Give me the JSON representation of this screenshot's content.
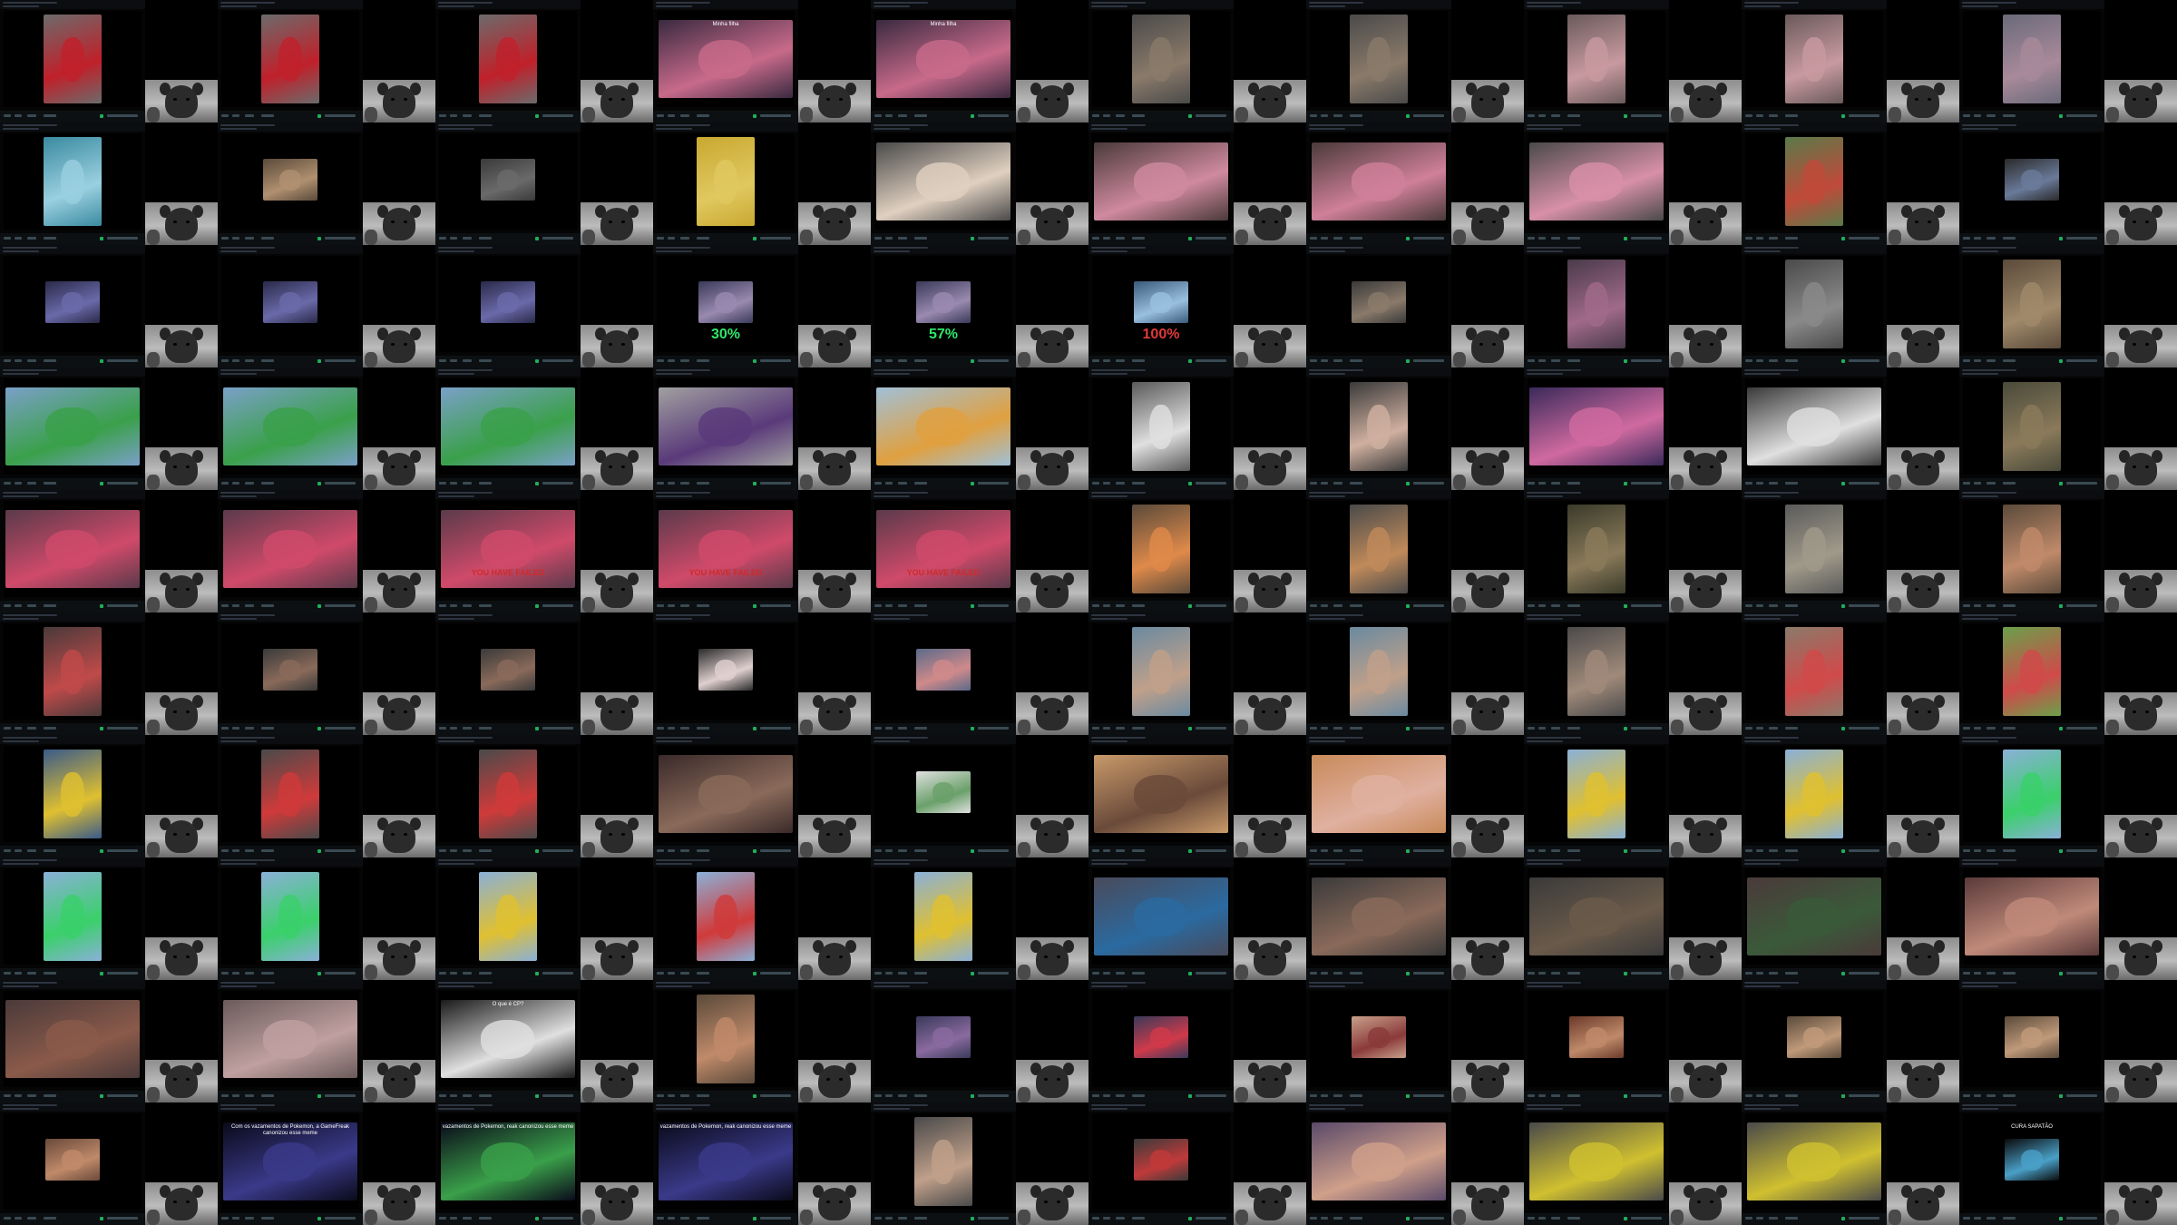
{
  "screen": {
    "title": ""
  },
  "tiles": [
    {
      "bg": "#6b6b6b",
      "accent": "#c0202a",
      "shape": "tall",
      "caption": "",
      "overlay": "",
      "overlayColor": "#fff"
    },
    {
      "bg": "#6b6b6b",
      "accent": "#c0202a",
      "shape": "tall",
      "caption": "",
      "overlay": "",
      "overlayColor": "#fff"
    },
    {
      "bg": "#6b6b6b",
      "accent": "#c0202a",
      "shape": "tall",
      "caption": "",
      "overlay": "",
      "overlayColor": "#fff"
    },
    {
      "bg": "#3a2a40",
      "accent": "#c86a8a",
      "shape": "wide",
      "caption": "Minha filha",
      "overlay": "",
      "overlayColor": "#fff"
    },
    {
      "bg": "#3a2a40",
      "accent": "#c86a8a",
      "shape": "wide",
      "caption": "Minha filha",
      "overlay": "",
      "overlayColor": "#fff"
    },
    {
      "bg": "#4a4a4a",
      "accent": "#8a7a6a",
      "shape": "tall",
      "caption": "",
      "overlay": "",
      "overlayColor": "#fff"
    },
    {
      "bg": "#4a4a4a",
      "accent": "#8a7a6a",
      "shape": "tall",
      "caption": "",
      "overlay": "",
      "overlayColor": "#fff"
    },
    {
      "bg": "#6a5a5a",
      "accent": "#c89aa0",
      "shape": "tall",
      "caption": "",
      "overlay": "",
      "overlayColor": "#fff"
    },
    {
      "bg": "#6a5a5a",
      "accent": "#c89aa0",
      "shape": "tall",
      "caption": "",
      "overlay": "",
      "overlayColor": "#fff"
    },
    {
      "bg": "#6a6a7a",
      "accent": "#a88a9a",
      "shape": "tall",
      "caption": "",
      "overlay": "",
      "overlayColor": "#fff"
    },
    {
      "bg": "#3a8aa0",
      "accent": "#9ad0e0",
      "shape": "tall",
      "caption": "",
      "overlay": "",
      "overlayColor": "#fff"
    },
    {
      "bg": "#5a4a3a",
      "accent": "#b09070",
      "shape": "small",
      "caption": "",
      "overlay": "",
      "overlayColor": "#fff"
    },
    {
      "bg": "#3a3a3a",
      "accent": "#6a6a6a",
      "shape": "small",
      "caption": "",
      "overlay": "",
      "overlayColor": "#fff"
    },
    {
      "bg": "#c8a830",
      "accent": "#e0c860",
      "shape": "tall",
      "caption": "",
      "overlay": "",
      "overlayColor": "#fff"
    },
    {
      "bg": "#4a4a4a",
      "accent": "#e0d0c0",
      "shape": "wide",
      "caption": "",
      "overlay": "",
      "overlayColor": "#fff"
    },
    {
      "bg": "#4a3a3a",
      "accent": "#d08aa0",
      "shape": "wide",
      "caption": "",
      "overlay": "",
      "overlayColor": "#fff"
    },
    {
      "bg": "#4a3a3a",
      "accent": "#d0809a",
      "shape": "wide",
      "caption": "",
      "overlay": "",
      "overlayColor": "#fff"
    },
    {
      "bg": "#4a4a4a",
      "accent": "#d890a8",
      "shape": "wide",
      "caption": "",
      "overlay": "",
      "overlayColor": "#fff"
    },
    {
      "bg": "#5a7a4a",
      "accent": "#c04a3a",
      "shape": "tall",
      "caption": "",
      "overlay": "",
      "overlayColor": "#fff"
    },
    {
      "bg": "#2a2a2a",
      "accent": "#6a7a9a",
      "shape": "small",
      "caption": "",
      "overlay": "",
      "overlayColor": "#fff"
    },
    {
      "bg": "#2a2a4a",
      "accent": "#6a6aaa",
      "shape": "small",
      "caption": "",
      "overlay": "",
      "overlayColor": "#fff"
    },
    {
      "bg": "#2a2a4a",
      "accent": "#6a6aaa",
      "shape": "small",
      "caption": "",
      "overlay": "",
      "overlayColor": "#fff"
    },
    {
      "bg": "#2a2a4a",
      "accent": "#6a6aaa",
      "shape": "small",
      "caption": "",
      "overlay": "",
      "overlayColor": "#fff"
    },
    {
      "bg": "#3a3a5a",
      "accent": "#9a8ab0",
      "shape": "small",
      "caption": "",
      "overlay": "30%",
      "overlayColor": "#2ee86a"
    },
    {
      "bg": "#3a3a5a",
      "accent": "#9a8ab0",
      "shape": "small",
      "caption": "",
      "overlay": "57%",
      "overlayColor": "#2ee86a"
    },
    {
      "bg": "#3a5a7a",
      "accent": "#9ac0e0",
      "shape": "small",
      "caption": "",
      "overlay": "100%",
      "overlayColor": "#e23a3a"
    },
    {
      "bg": "#3a3a3a",
      "accent": "#8a7a6a",
      "shape": "small",
      "caption": "",
      "overlay": "",
      "overlayColor": "#fff"
    },
    {
      "bg": "#4a3a4a",
      "accent": "#a06a8a",
      "shape": "tall",
      "caption": "",
      "overlay": "",
      "overlayColor": "#fff"
    },
    {
      "bg": "#4a4a4a",
      "accent": "#8a8a8a",
      "shape": "tall",
      "caption": "",
      "overlay": "",
      "overlayColor": "#fff"
    },
    {
      "bg": "#5a4a3a",
      "accent": "#a08a6a",
      "shape": "tall",
      "caption": "",
      "overlay": "",
      "overlayColor": "#fff"
    },
    {
      "bg": "#7aa0c8",
      "accent": "#3aa04a",
      "shape": "wide",
      "caption": "",
      "overlay": "",
      "overlayColor": "#fff"
    },
    {
      "bg": "#7aa0c8",
      "accent": "#3aa04a",
      "shape": "wide",
      "caption": "",
      "overlay": "",
      "overlayColor": "#fff"
    },
    {
      "bg": "#7aa0c8",
      "accent": "#3aa04a",
      "shape": "wide",
      "caption": "",
      "overlay": "",
      "overlayColor": "#fff"
    },
    {
      "bg": "#a0a0a0",
      "accent": "#5a3a7a",
      "shape": "wide",
      "caption": "",
      "overlay": "",
      "overlayColor": "#fff"
    },
    {
      "bg": "#a0c0d8",
      "accent": "#e0a040",
      "shape": "wide",
      "caption": "",
      "overlay": "",
      "overlayColor": "#fff"
    },
    {
      "bg": "#5a5a5a",
      "accent": "#e0e0e0",
      "shape": "tall",
      "caption": "",
      "overlay": "",
      "overlayColor": "#fff"
    },
    {
      "bg": "#3a3a3a",
      "accent": "#d0b0a0",
      "shape": "tall",
      "caption": "",
      "overlay": "",
      "overlayColor": "#fff"
    },
    {
      "bg": "#3a2a5a",
      "accent": "#d06aa0",
      "shape": "wide",
      "caption": "",
      "overlay": "",
      "overlayColor": "#fff"
    },
    {
      "bg": "#3a3a3a",
      "accent": "#e0e0e0",
      "shape": "wide",
      "caption": "",
      "overlay": "",
      "overlayColor": "#fff"
    },
    {
      "bg": "#4a4a3a",
      "accent": "#8a7a5a",
      "shape": "tall",
      "caption": "",
      "overlay": "",
      "overlayColor": "#fff"
    },
    {
      "bg": "#5a3a4a",
      "accent": "#d04a6a",
      "shape": "wide",
      "caption": "",
      "overlay": "",
      "overlayColor": "#fff"
    },
    {
      "bg": "#5a3a4a",
      "accent": "#d04a6a",
      "shape": "wide",
      "caption": "",
      "overlay": "",
      "overlayColor": "#fff"
    },
    {
      "bg": "#5a3a4a",
      "accent": "#d04a6a",
      "shape": "wide",
      "caption": "",
      "overlay": "YOU HAVE FAILED",
      "overlayColor": "#d02a2a"
    },
    {
      "bg": "#5a3a4a",
      "accent": "#d04a6a",
      "shape": "wide",
      "caption": "",
      "overlay": "YOU HAVE FAILED",
      "overlayColor": "#d02a2a"
    },
    {
      "bg": "#5a3a4a",
      "accent": "#d04a6a",
      "shape": "wide",
      "caption": "",
      "overlay": "YOU HAVE FAILED",
      "overlayColor": "#d02a2a"
    },
    {
      "bg": "#5a4a3a",
      "accent": "#e08a4a",
      "shape": "tall",
      "caption": "",
      "overlay": "",
      "overlayColor": "#fff"
    },
    {
      "bg": "#4a4a4a",
      "accent": "#c08a5a",
      "shape": "tall",
      "caption": "",
      "overlay": "",
      "overlayColor": "#fff"
    },
    {
      "bg": "#3a3a2a",
      "accent": "#8a7a5a",
      "shape": "tall",
      "caption": "",
      "overlay": "",
      "overlayColor": "#fff"
    },
    {
      "bg": "#5a5a5a",
      "accent": "#a09a8a",
      "shape": "tall",
      "caption": "",
      "overlay": "",
      "overlayColor": "#fff"
    },
    {
      "bg": "#5a4a3a",
      "accent": "#c08a6a",
      "shape": "tall",
      "caption": "",
      "overlay": "",
      "overlayColor": "#fff"
    },
    {
      "bg": "#4a3a3a",
      "accent": "#c04a4a",
      "shape": "tall",
      "caption": "",
      "overlay": "",
      "overlayColor": "#fff"
    },
    {
      "bg": "#3a3a3a",
      "accent": "#8a6a5a",
      "shape": "small",
      "caption": "",
      "overlay": "",
      "overlayColor": "#fff"
    },
    {
      "bg": "#3a3a3a",
      "accent": "#8a6a5a",
      "shape": "small",
      "caption": "",
      "overlay": "",
      "overlayColor": "#fff"
    },
    {
      "bg": "#2a2a2a",
      "accent": "#e0d0d0",
      "shape": "small",
      "caption": "",
      "overlay": "",
      "overlayColor": "#fff"
    },
    {
      "bg": "#5a6a8a",
      "accent": "#d08a8a",
      "shape": "small",
      "caption": "",
      "overlay": "",
      "overlayColor": "#fff"
    },
    {
      "bg": "#6a8aa0",
      "accent": "#c0a08a",
      "shape": "tall",
      "caption": "",
      "overlay": "",
      "overlayColor": "#fff"
    },
    {
      "bg": "#6a8aa0",
      "accent": "#c0a08a",
      "shape": "tall",
      "caption": "",
      "overlay": "",
      "overlayColor": "#fff"
    },
    {
      "bg": "#4a4a4a",
      "accent": "#a08a7a",
      "shape": "tall",
      "caption": "",
      "overlay": "",
      "overlayColor": "#fff"
    },
    {
      "bg": "#8a7a6a",
      "accent": "#d04a4a",
      "shape": "tall",
      "caption": "",
      "overlay": "",
      "overlayColor": "#fff"
    },
    {
      "bg": "#6aa04a",
      "accent": "#d04a4a",
      "shape": "tall",
      "caption": "",
      "overlay": "",
      "overlayColor": "#fff"
    },
    {
      "bg": "#3a5a8a",
      "accent": "#e0c030",
      "shape": "tall",
      "caption": "",
      "overlay": "",
      "overlayColor": "#fff"
    },
    {
      "bg": "#4a4a4a",
      "accent": "#d03a3a",
      "shape": "tall",
      "caption": "",
      "overlay": "",
      "overlayColor": "#fff"
    },
    {
      "bg": "#4a4a4a",
      "accent": "#d03a3a",
      "shape": "tall",
      "caption": "",
      "overlay": "",
      "overlayColor": "#fff"
    },
    {
      "bg": "#3a2a2a",
      "accent": "#8a6a5a",
      "shape": "wide",
      "caption": "",
      "overlay": "",
      "overlayColor": "#fff"
    },
    {
      "bg": "#e0e0e0",
      "accent": "#6aa06a",
      "shape": "small",
      "caption": "",
      "overlay": "",
      "overlayColor": "#fff"
    },
    {
      "bg": "#c89a6a",
      "accent": "#6a4a3a",
      "shape": "wide",
      "caption": "",
      "overlay": "",
      "overlayColor": "#fff"
    },
    {
      "bg": "#c88a5a",
      "accent": "#e0b0a0",
      "shape": "wide",
      "caption": "",
      "overlay": "",
      "overlayColor": "#fff"
    },
    {
      "bg": "#8ab0d8",
      "accent": "#e0c030",
      "shape": "tall",
      "caption": "",
      "overlay": "",
      "overlayColor": "#fff"
    },
    {
      "bg": "#8ab0d8",
      "accent": "#e0c030",
      "shape": "tall",
      "caption": "",
      "overlay": "",
      "overlayColor": "#fff"
    },
    {
      "bg": "#8ab0d8",
      "accent": "#3ad06a",
      "shape": "tall",
      "caption": "",
      "overlay": "",
      "overlayColor": "#fff"
    },
    {
      "bg": "#8ab0d8",
      "accent": "#3ad06a",
      "shape": "tall",
      "caption": "",
      "overlay": "",
      "overlayColor": "#fff"
    },
    {
      "bg": "#8ab0d8",
      "accent": "#3ad06a",
      "shape": "tall",
      "caption": "",
      "overlay": "",
      "overlayColor": "#fff"
    },
    {
      "bg": "#8ab0d8",
      "accent": "#e0c030",
      "shape": "tall",
      "caption": "",
      "overlay": "",
      "overlayColor": "#fff"
    },
    {
      "bg": "#8ab0d8",
      "accent": "#d03a3a",
      "shape": "tall",
      "caption": "",
      "overlay": "",
      "overlayColor": "#fff"
    },
    {
      "bg": "#8ab0d8",
      "accent": "#e0c030",
      "shape": "tall",
      "caption": "",
      "overlay": "",
      "overlayColor": "#fff"
    },
    {
      "bg": "#4a4a5a",
      "accent": "#2a6aa0",
      "shape": "wide",
      "caption": "",
      "overlay": "",
      "overlayColor": "#fff"
    },
    {
      "bg": "#3a3a3a",
      "accent": "#8a6a5a",
      "shape": "wide",
      "caption": "",
      "overlay": "",
      "overlayColor": "#fff"
    },
    {
      "bg": "#3a3a3a",
      "accent": "#6a5a4a",
      "shape": "wide",
      "caption": "",
      "overlay": "",
      "overlayColor": "#fff"
    },
    {
      "bg": "#4a3a3a",
      "accent": "#3a5a3a",
      "shape": "wide",
      "caption": "",
      "overlay": "",
      "overlayColor": "#fff"
    },
    {
      "bg": "#5a3a3a",
      "accent": "#c08a7a",
      "shape": "wide",
      "caption": "",
      "overlay": "",
      "overlayColor": "#fff"
    },
    {
      "bg": "#4a3a3a",
      "accent": "#8a5a4a",
      "shape": "wide",
      "caption": "",
      "overlay": "",
      "overlayColor": "#fff"
    },
    {
      "bg": "#6a5a5a",
      "accent": "#c0a0a0",
      "shape": "wide",
      "caption": "",
      "overlay": "",
      "overlayColor": "#fff"
    },
    {
      "bg": "#1a1a1a",
      "accent": "#e0e0e0",
      "shape": "wide",
      "caption": "O que é CP?",
      "overlay": "",
      "overlayColor": "#fff"
    },
    {
      "bg": "#5a4a3a",
      "accent": "#c08a6a",
      "shape": "tall",
      "caption": "",
      "overlay": "",
      "overlayColor": "#fff"
    },
    {
      "bg": "#3a3a5a",
      "accent": "#8a6aa0",
      "shape": "small",
      "caption": "",
      "overlay": "",
      "overlayColor": "#fff"
    },
    {
      "bg": "#3a3a5a",
      "accent": "#d03a4a",
      "shape": "small",
      "caption": "",
      "overlay": "",
      "overlayColor": "#fff"
    },
    {
      "bg": "#c8a08a",
      "accent": "#8a3a3a",
      "shape": "small",
      "caption": "",
      "overlay": "",
      "overlayColor": "#fff"
    },
    {
      "bg": "#6a3a2a",
      "accent": "#c08a6a",
      "shape": "small",
      "caption": "",
      "overlay": "",
      "overlayColor": "#fff"
    },
    {
      "bg": "#5a4a3a",
      "accent": "#c09a7a",
      "shape": "small",
      "caption": "",
      "overlay": "",
      "overlayColor": "#fff"
    },
    {
      "bg": "#5a4a3a",
      "accent": "#c09a7a",
      "shape": "small",
      "caption": "",
      "overlay": "",
      "overlayColor": "#fff"
    },
    {
      "bg": "#6a4a3a",
      "accent": "#c08a6a",
      "shape": "small",
      "caption": "",
      "overlay": "",
      "overlayColor": "#fff"
    },
    {
      "bg": "#0a0a1a",
      "accent": "#3a3a8a",
      "shape": "wide",
      "caption": "Com os vazamentos de Pokemon, a GameFreak canonizou esse meme",
      "overlay": "",
      "overlayColor": "#fff"
    },
    {
      "bg": "#0a0a1a",
      "accent": "#3aa04a",
      "shape": "wide",
      "caption": "vazamentos de Pokemon, reak canonizou esse meme",
      "overlay": "",
      "overlayColor": "#fff"
    },
    {
      "bg": "#0a0a1a",
      "accent": "#3a3a8a",
      "shape": "wide",
      "caption": "vazamentos de Pokemon, reak canonizou esse meme",
      "overlay": "",
      "overlayColor": "#fff"
    },
    {
      "bg": "#4a4a4a",
      "accent": "#c0a08a",
      "shape": "tall",
      "caption": "",
      "overlay": "",
      "overlayColor": "#fff"
    },
    {
      "bg": "#3a3a3a",
      "accent": "#c03a3a",
      "shape": "small",
      "caption": "",
      "overlay": "",
      "overlayColor": "#fff"
    },
    {
      "bg": "#5a4a6a",
      "accent": "#d0a08a",
      "shape": "wide",
      "caption": "",
      "overlay": "",
      "overlayColor": "#fff"
    },
    {
      "bg": "#4a4a4a",
      "accent": "#d0c030",
      "shape": "wide",
      "caption": "",
      "overlay": "",
      "overlayColor": "#fff"
    },
    {
      "bg": "#4a4a4a",
      "accent": "#d0c030",
      "shape": "wide",
      "caption": "",
      "overlay": "",
      "overlayColor": "#fff"
    },
    {
      "bg": "#0a0a0a",
      "accent": "#4aa0c8",
      "shape": "small",
      "caption": "CURA SAPATÃO",
      "overlay": "",
      "overlayColor": "#fff"
    }
  ]
}
